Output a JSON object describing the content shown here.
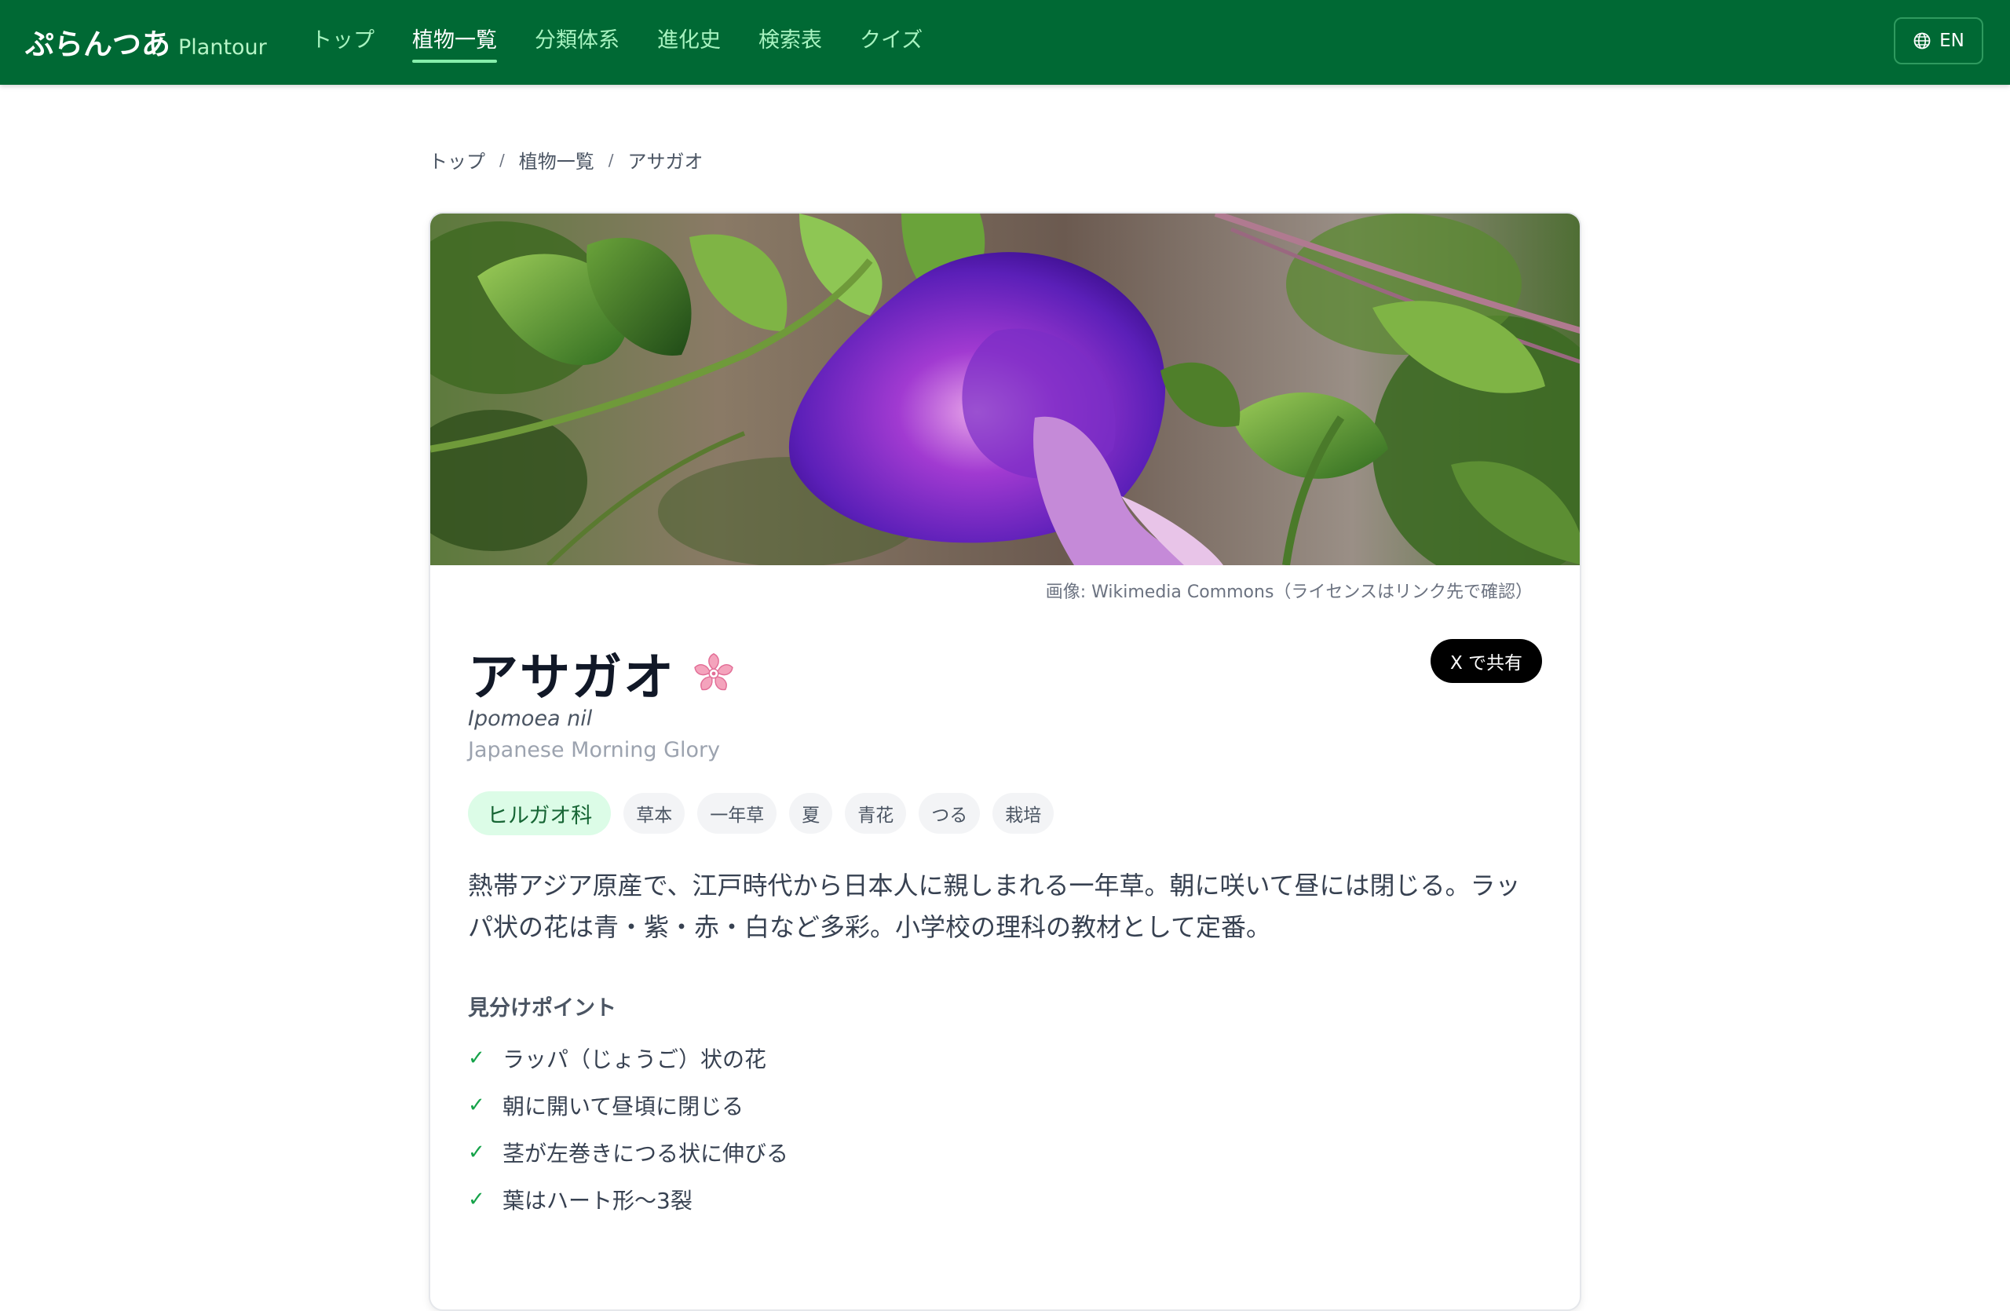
{
  "app": {
    "brand_jp": "ぷらんつあ",
    "brand_en": "Plantour"
  },
  "nav": {
    "items": [
      {
        "label": "トップ",
        "active": false
      },
      {
        "label": "植物一覧",
        "active": true
      },
      {
        "label": "分類体系",
        "active": false
      },
      {
        "label": "進化史",
        "active": false
      },
      {
        "label": "検索表",
        "active": false
      },
      {
        "label": "クイズ",
        "active": false
      }
    ],
    "lang_label": "EN",
    "lang_icon": "globe-icon"
  },
  "breadcrumb": {
    "items": [
      "トップ",
      "植物一覧",
      "アサガオ"
    ],
    "separator": "/"
  },
  "plant": {
    "image_credit": "画像: Wikimedia Commons（ライセンスはリンク先で確認）",
    "name": "アサガオ",
    "name_icon": "cherry-blossom-icon",
    "scientific_name": "Ipomoea nil",
    "english_name": "Japanese Morning Glory",
    "share_label": "X で共有",
    "family_tag": "ヒルガオ科",
    "tags": [
      "草本",
      "一年草",
      "夏",
      "青花",
      "つる",
      "栽培"
    ],
    "description": "熱帯アジア原産で、江戸時代から日本人に親しまれる一年草。朝に咲いて昼には閉じる。ラッパ状の花は青・紫・赤・白など多彩。小学校の理科の教材として定番。",
    "points_title": "見分けポイント",
    "points": [
      "ラッパ（じょうご）状の花",
      "朝に開いて昼頃に閉じる",
      "茎が左巻きにつる状に伸びる",
      "葉はハート形〜3裂"
    ],
    "check_mark": "✓"
  },
  "colors": {
    "header_bg": "#006934",
    "nav_inactive": "#a7f3c0",
    "family_tag_bg": "#dcfce7",
    "family_tag_text": "#166534",
    "check": "#16a34a"
  }
}
